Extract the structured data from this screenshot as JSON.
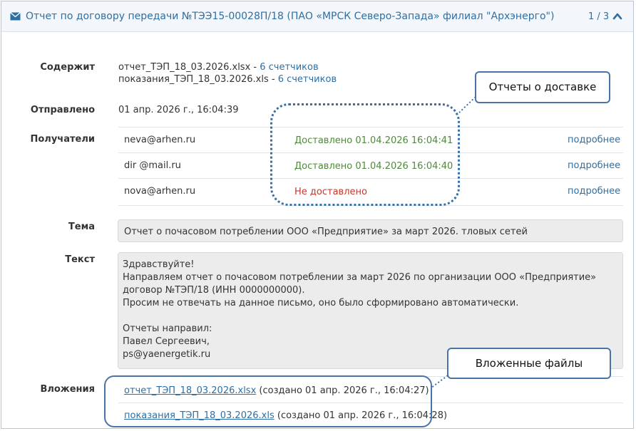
{
  "header": {
    "title": "Отчет по договору передачи №ТЭЭ15-00028П/18 (ПАО «МРСК Северо-Запада» филиал \"Архэнерго\")",
    "counter": "1 / 3"
  },
  "labels": {
    "contains": "Содержит",
    "sent": "Отправлено",
    "recipients": "Получатели",
    "subject": "Тема",
    "text": "Текст",
    "attachments": "Вложения"
  },
  "contains": [
    {
      "file": "отчет_ТЭП_18_03.2026.xlsx",
      "sep": " - ",
      "count": "6 счетчиков"
    },
    {
      "file": "показания_ТЭП_18_03.2026.xls",
      "sep": " - ",
      "count": "6 счетчиков"
    }
  ],
  "sent": "01 апр. 2026 г., 16:04:39",
  "recipients": [
    {
      "email": "neva@arhen.ru",
      "status": "Доставлено 01.04.2026 16:04:41",
      "more": "подробнее"
    },
    {
      "email": "dir @mail.ru",
      "status": "Доставлено 01.04.2026 16:04:40",
      "more": "подробнее"
    },
    {
      "email": "nova@arhen.ru",
      "status": "Не доставлено",
      "more": "подробнее"
    }
  ],
  "subject": "Отчет о почасовом потреблении ООО «Предприятие» за март 2026.  тловых сетей",
  "text_lines": [
    "Здравствуйте!",
    "Направляем отчет о почасовом потреблении за март 2026 по организации ООО «Предприятие»",
    "договор №ТЭП/18 (ИНН 0000000000).",
    "Просим не отвечать на данное письмо, оно было сформировано автоматически.",
    "",
    "Отчеты направил:",
    "Павел Сергеевич,",
    "ps@yaenergetik.ru"
  ],
  "attachments": [
    {
      "file": "отчет_ТЭП_18_03.2026.xlsx",
      "created": " (создано 01 апр. 2026 г., 16:04:27)"
    },
    {
      "file": "показания_ТЭП_18_03.2026.xls",
      "created": " (создано 01 апр. 2026 г., 16:04:28)"
    }
  ],
  "callouts": {
    "delivery": "Отчеты о доставке",
    "files": "Вложенные файлы"
  },
  "colors": {
    "accent": "#2e6fa3",
    "delivered": "#4e8a3a",
    "not_delivered": "#c0392b",
    "callout_border": "#4a74a8"
  },
  "icons": [
    "envelope-icon",
    "chevron-up-icon"
  ]
}
